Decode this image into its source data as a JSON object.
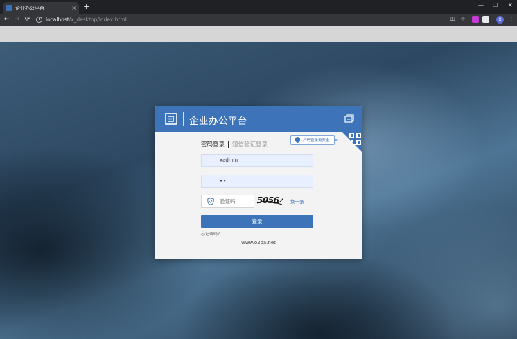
{
  "browser": {
    "tab": {
      "title": "企业办公平台",
      "close": "×"
    },
    "new_tab": "+",
    "window_controls": {
      "minimize": "—",
      "maximize": "☐",
      "close": "✕"
    },
    "nav": {
      "back": "←",
      "forward": "→",
      "reload": "⟳"
    },
    "url": {
      "host": "localhost",
      "path": "/x_desktop/index.html"
    },
    "toolbar_icons": {
      "key": "⚿",
      "star": "☆",
      "menu": "⋮"
    },
    "avatar_letter": "X"
  },
  "login": {
    "title": "企业办公平台",
    "qr_badge": "扫码登录更安全",
    "tabs": {
      "password": "密码登录",
      "sms": "短信验证登录"
    },
    "username_value": "xadmin",
    "password_value": "••",
    "captcha_placeholder": "验证码",
    "captcha_code": "5056",
    "captcha_refresh": "换一张",
    "submit": "登录",
    "forgot": "忘记密码?",
    "site": "www.o2oa.net"
  },
  "colors": {
    "accent": "#3d74b9",
    "input_bg": "#e8efff",
    "card_bg": "#f3f3f3"
  }
}
